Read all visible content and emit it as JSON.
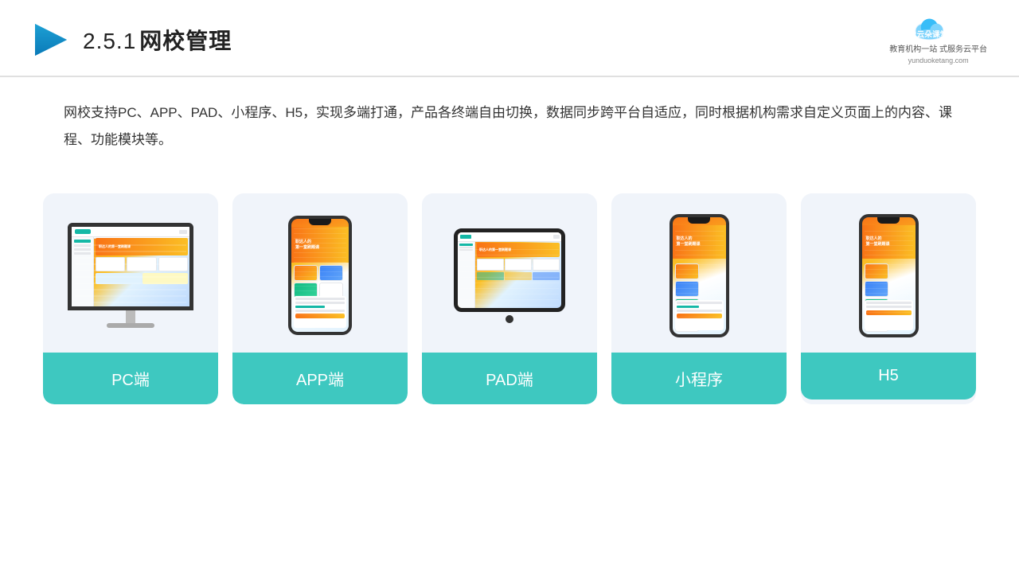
{
  "header": {
    "slide_number": "2.5.1",
    "title": "网校管理",
    "logo_name": "云朵课堂",
    "logo_domain": "yunduoketang.com",
    "logo_tagline": "教育机构一站\n式服务云平台"
  },
  "description": {
    "text": "网校支持PC、APP、PAD、小程序、H5，实现多端打通，产品各终端自由切换，数据同步跨平台自适应，同时根据机构需求自定义页面上的内容、课程、功能模块等。"
  },
  "cards": [
    {
      "id": "pc",
      "label": "PC端",
      "type": "monitor"
    },
    {
      "id": "app",
      "label": "APP端",
      "type": "phone"
    },
    {
      "id": "pad",
      "label": "PAD端",
      "type": "pad"
    },
    {
      "id": "miniprogram",
      "label": "小程序",
      "type": "phone-tall"
    },
    {
      "id": "h5",
      "label": "H5",
      "type": "phone-tall"
    }
  ],
  "accent_color": "#3ec8c0"
}
